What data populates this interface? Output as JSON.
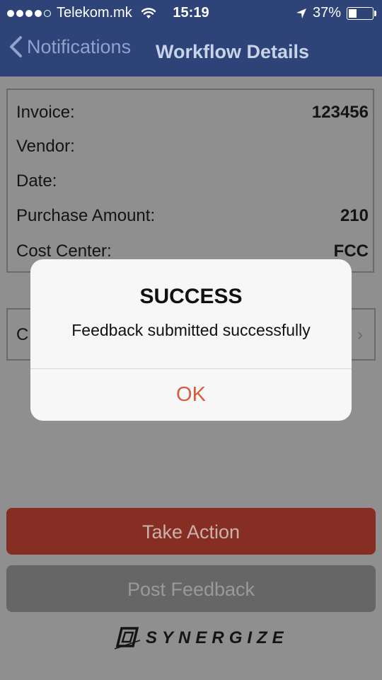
{
  "status_bar": {
    "carrier": "Telekom.mk",
    "time": "15:19",
    "battery": "37%",
    "battery_level": 0.37,
    "icons": [
      "signal-dots",
      "wifi-icon",
      "location-arrow-icon",
      "battery-icon"
    ]
  },
  "nav": {
    "back_label": "Notifications",
    "title": "Workflow Details",
    "back_icon": "chevron-left-icon"
  },
  "details": {
    "rows": [
      {
        "label": "Invoice:",
        "value": "123456"
      },
      {
        "label": "Vendor:",
        "value": ""
      },
      {
        "label": "Date:",
        "value": ""
      },
      {
        "label": "Purchase Amount:",
        "value": "210"
      },
      {
        "label": "Cost Center:",
        "value": "FCC"
      }
    ]
  },
  "comments_card": {
    "label_visible": "C"
  },
  "buttons": {
    "take_action": "Take Action",
    "post_feedback": "Post Feedback"
  },
  "logo": {
    "text": "SYNERGIZE"
  },
  "alert": {
    "title": "SUCCESS",
    "message": "Feedback submitted successfully",
    "ok_label": "OK"
  },
  "colors": {
    "header": "#2e4377",
    "take_action": "#862e24",
    "post_feedback": "#666666",
    "ok_text": "#d85c3f"
  }
}
